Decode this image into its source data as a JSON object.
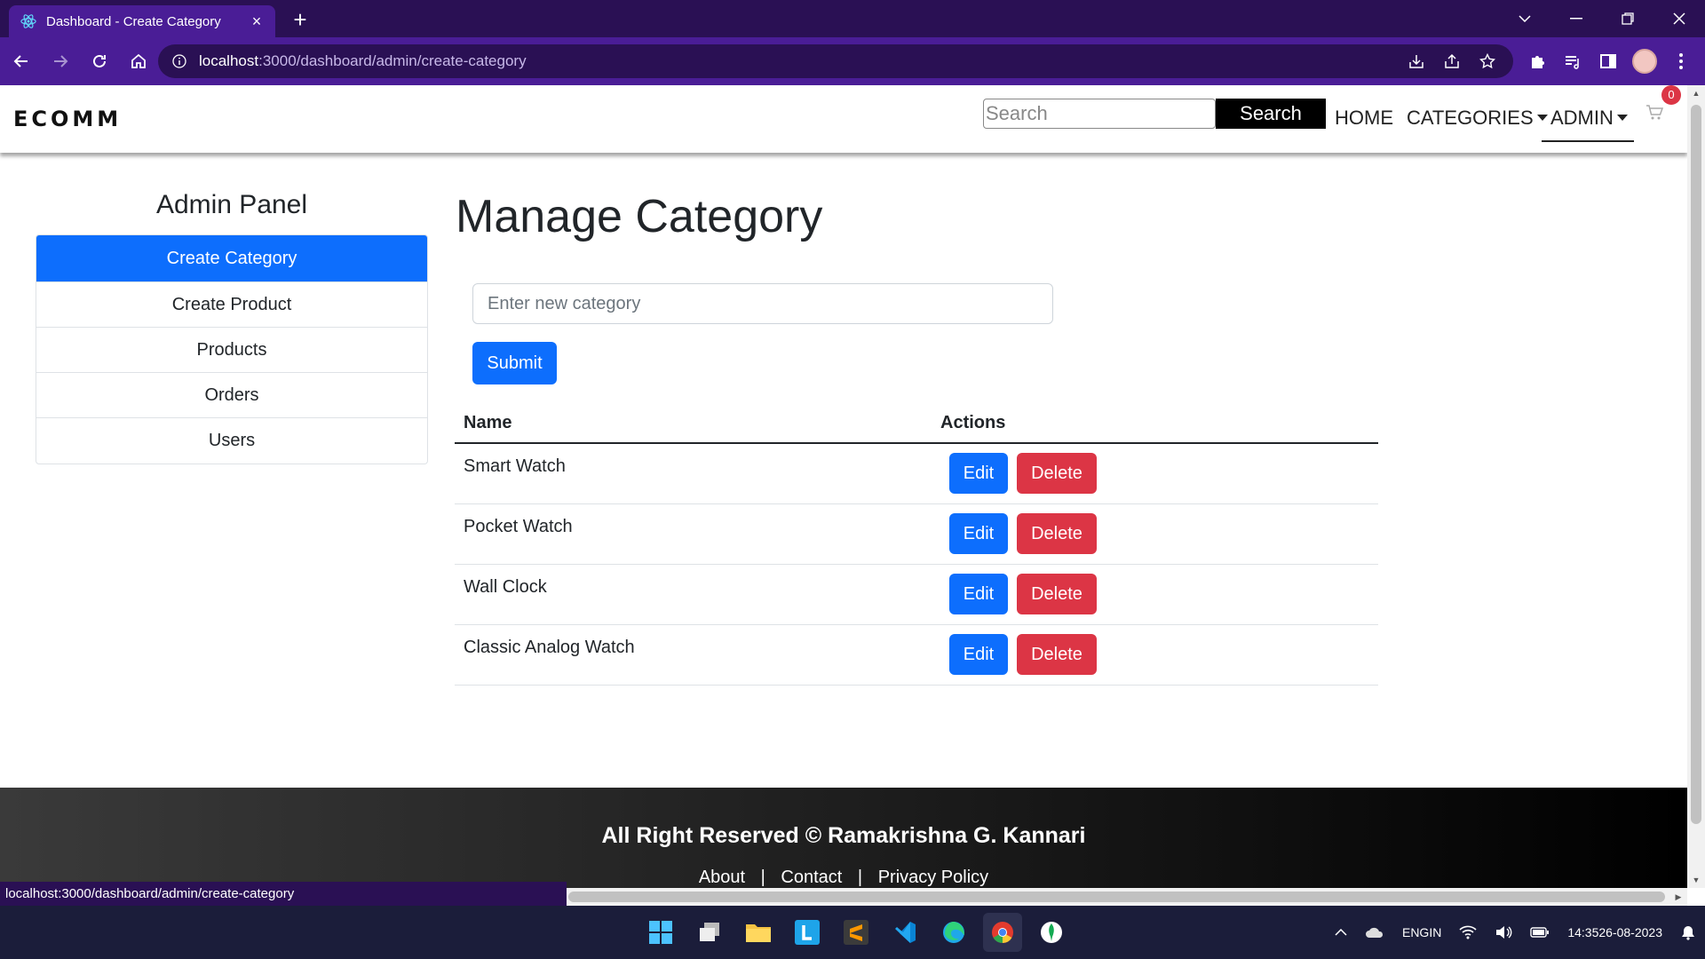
{
  "browser": {
    "tab_title": "Dashboard - Create Category",
    "url_host": "localhost",
    "url_path": ":3000/dashboard/admin/create-category",
    "status_url": "localhost:3000/dashboard/admin/create-category"
  },
  "header": {
    "brand": "ECOMM",
    "search_placeholder": "Search",
    "search_button": "Search",
    "nav": {
      "home": "HOME",
      "categories": "CATEGORIES",
      "admin": "ADMIN"
    },
    "cart_count": "0"
  },
  "sidebar": {
    "title": "Admin Panel",
    "items": [
      {
        "label": "Create Category",
        "active": true
      },
      {
        "label": "Create Product",
        "active": false
      },
      {
        "label": "Products",
        "active": false
      },
      {
        "label": "Orders",
        "active": false
      },
      {
        "label": "Users",
        "active": false
      }
    ]
  },
  "main": {
    "title": "Manage Category",
    "input_placeholder": "Enter new category",
    "submit_label": "Submit",
    "table": {
      "columns": [
        "Name",
        "Actions"
      ],
      "rows": [
        {
          "name": "Smart Watch"
        },
        {
          "name": "Pocket Watch"
        },
        {
          "name": "Wall Clock"
        },
        {
          "name": "Classic Analog Watch"
        }
      ],
      "edit_label": "Edit",
      "delete_label": "Delete"
    }
  },
  "footer": {
    "copyright": "All Right Reserved © Ramakrishna G. Kannari",
    "links": [
      "About",
      "Contact",
      "Privacy Policy"
    ],
    "separator": "|"
  },
  "taskbar": {
    "lang_top": "ENG",
    "lang_bottom": "IN",
    "time": "14:35",
    "date": "26-08-2023"
  },
  "colors": {
    "browser_frame": "#2a1054",
    "browser_toolbar": "#4a1d96",
    "primary": "#0d6efd",
    "danger": "#dc3545",
    "taskbar": "#1b1d3a"
  }
}
